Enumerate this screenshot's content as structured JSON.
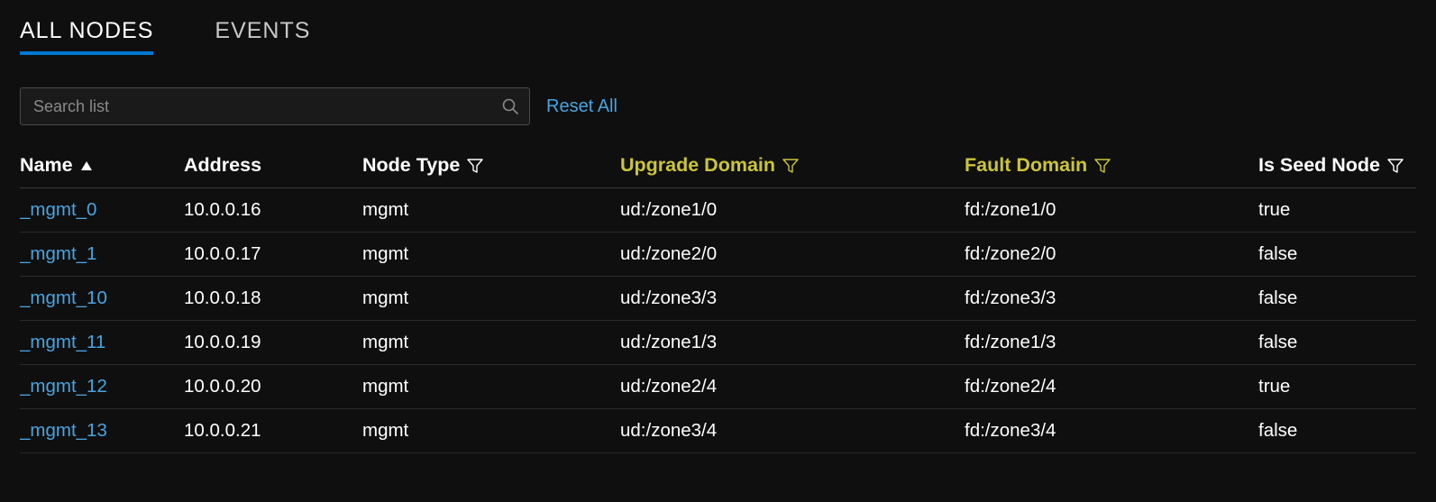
{
  "tabs": {
    "all_nodes": "ALL NODES",
    "events": "EVENTS"
  },
  "toolbar": {
    "search_placeholder": "Search list",
    "reset_all": "Reset All"
  },
  "columns": {
    "name": "Name",
    "address": "Address",
    "node_type": "Node Type",
    "upgrade_domain": "Upgrade Domain",
    "fault_domain": "Fault Domain",
    "is_seed_node": "Is Seed Node"
  },
  "rows": [
    {
      "name": "_mgmt_0",
      "address": "10.0.0.16",
      "node_type": "mgmt",
      "upgrade_domain": "ud:/zone1/0",
      "fault_domain": "fd:/zone1/0",
      "is_seed_node": "true"
    },
    {
      "name": "_mgmt_1",
      "address": "10.0.0.17",
      "node_type": "mgmt",
      "upgrade_domain": "ud:/zone2/0",
      "fault_domain": "fd:/zone2/0",
      "is_seed_node": "false"
    },
    {
      "name": "_mgmt_10",
      "address": "10.0.0.18",
      "node_type": "mgmt",
      "upgrade_domain": "ud:/zone3/3",
      "fault_domain": "fd:/zone3/3",
      "is_seed_node": "false"
    },
    {
      "name": "_mgmt_11",
      "address": "10.0.0.19",
      "node_type": "mgmt",
      "upgrade_domain": "ud:/zone1/3",
      "fault_domain": "fd:/zone1/3",
      "is_seed_node": "false"
    },
    {
      "name": "_mgmt_12",
      "address": "10.0.0.20",
      "node_type": "mgmt",
      "upgrade_domain": "ud:/zone2/4",
      "fault_domain": "fd:/zone2/4",
      "is_seed_node": "true"
    },
    {
      "name": "_mgmt_13",
      "address": "10.0.0.21",
      "node_type": "mgmt",
      "upgrade_domain": "ud:/zone3/4",
      "fault_domain": "fd:/zone3/4",
      "is_seed_node": "false"
    }
  ],
  "icons": {
    "sort_asc": "sort-asc-icon",
    "filter": "filter-icon",
    "search": "search-icon"
  },
  "colors": {
    "accent": "#0078d4",
    "link": "#4aa3df",
    "highlight_text": "#cbc43a",
    "bg": "#0f0f0f"
  }
}
